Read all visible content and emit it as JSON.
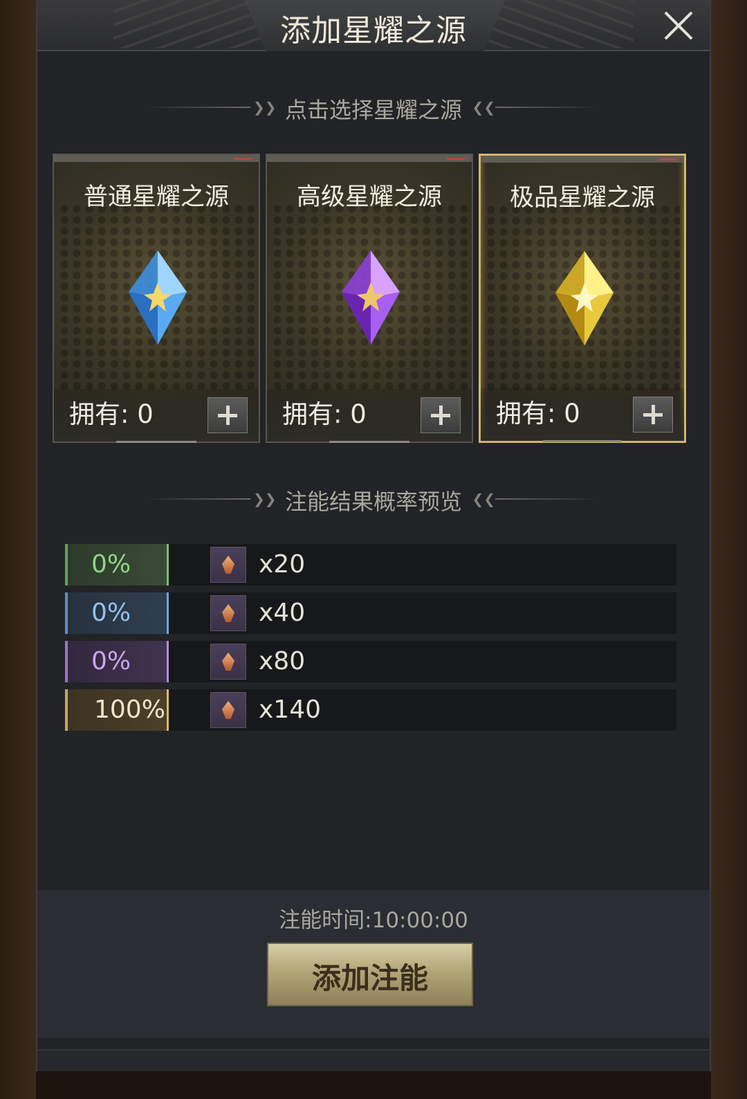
{
  "dialog": {
    "title": "添加星耀之源",
    "close_icon": "close-icon"
  },
  "select_section": {
    "heading": "点击选择星耀之源"
  },
  "cards": [
    {
      "title": "普通星耀之源",
      "owned": "拥有: 0",
      "gem_color": "#7fc4ff",
      "gem_icon": "blue-star-crystal-icon",
      "selected": false
    },
    {
      "title": "高级星耀之源",
      "owned": "拥有: 0",
      "gem_color": "#b56cff",
      "gem_icon": "purple-star-crystal-icon",
      "selected": false
    },
    {
      "title": "极品星耀之源",
      "owned": "拥有: 0",
      "gem_color": "#f2d24a",
      "gem_icon": "gold-star-crystal-icon",
      "selected": true
    }
  ],
  "preview_section": {
    "heading": "注能结果概率预览"
  },
  "probabilities": [
    {
      "percent": "0%",
      "quantity": "x20",
      "tier_color": "#79c06f"
    },
    {
      "percent": "0%",
      "quantity": "x40",
      "tier_color": "#6fa5dc"
    },
    {
      "percent": "0%",
      "quantity": "x80",
      "tier_color": "#b48bdc"
    },
    {
      "percent": "100%",
      "quantity": "x140",
      "tier_color": "#ddb968"
    }
  ],
  "footer": {
    "time_label": "注能时间:10:00:00",
    "add_button": "添加注能"
  }
}
